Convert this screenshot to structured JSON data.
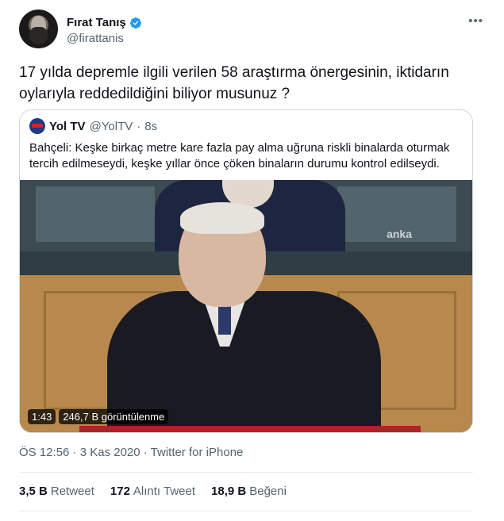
{
  "author": {
    "name": "Fırat Tanış",
    "handle": "@firattanis"
  },
  "tweet": {
    "text": "17 yılda depremle ilgili verilen 58 araştırma önergesinin, iktidarın oylarıyla reddedildiğini biliyor musunuz ?"
  },
  "quoted": {
    "name": "Yol TV",
    "handle": "@YolTV",
    "separator": "·",
    "time": "8s",
    "text": "Bahçeli: Keşke birkaç metre kare fazla pay alma uğruna riskli binalarda oturmak tercih edilmeseydi, keşke yıllar önce çöken binaların durumu kontrol edilseydi.",
    "video": {
      "duration": "1:43",
      "views": "246,7 B görüntülenme",
      "watermark": "anka"
    }
  },
  "meta": "ÖS 12:56 · 3 Kas 2020 · Twitter for iPhone",
  "stats": {
    "retweet_count": "3,5 B",
    "retweet_label": "Retweet",
    "quote_count": "172",
    "quote_label": "Alıntı Tweet",
    "like_count": "18,9 B",
    "like_label": "Beğeni"
  },
  "colors": {
    "verified": "#1d9bf0",
    "secondary_text": "#536471",
    "border": "#cfd9de"
  },
  "icons": {
    "verified": "verified-badge-icon",
    "more": "more-icon"
  }
}
